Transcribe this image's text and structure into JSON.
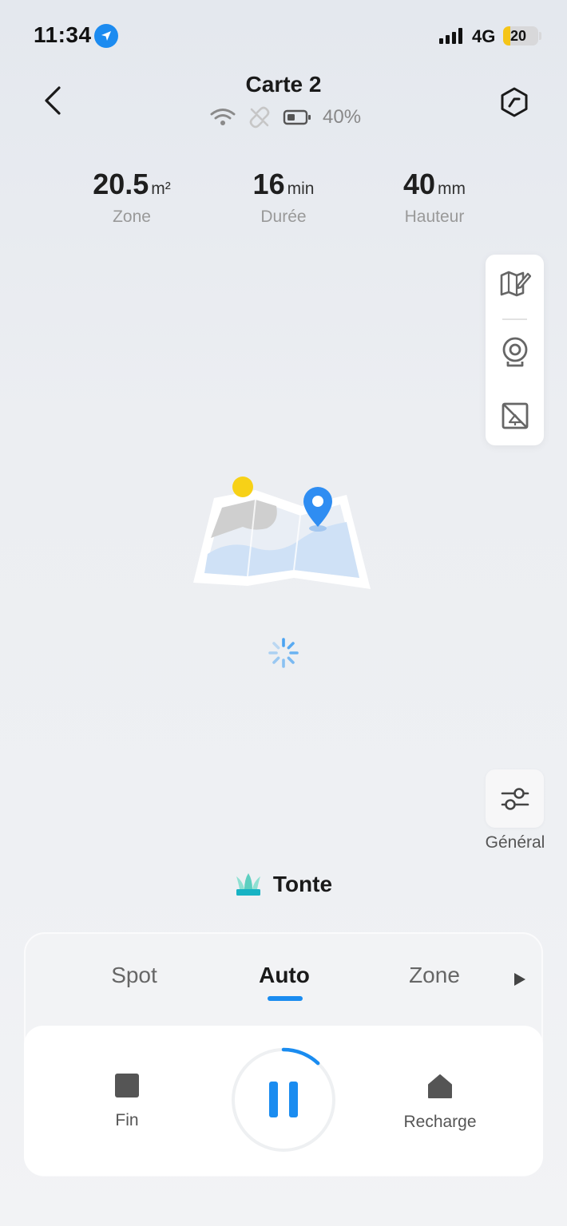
{
  "status_bar": {
    "time": "11:34",
    "network": "4G",
    "battery": "20",
    "battery_level": 0.2
  },
  "header": {
    "title": "Carte 2",
    "battery_percent": "40%"
  },
  "stats": [
    {
      "value": "20.5",
      "unit": "m²",
      "label": "Zone"
    },
    {
      "value": "16",
      "unit": "min",
      "label": "Durée"
    },
    {
      "value": "40",
      "unit": "mm",
      "label": "Hauteur"
    }
  ],
  "general": {
    "label": "Général"
  },
  "mode": {
    "title": "Tonte"
  },
  "tabs": [
    {
      "label": "Spot"
    },
    {
      "label": "Auto"
    },
    {
      "label": "Zone"
    }
  ],
  "controls": {
    "stop_label": "Fin",
    "recharge_label": "Recharge",
    "progress": 0.12
  },
  "colors": {
    "accent": "#1a8cf0",
    "sun": "#f7d117",
    "map_water": "#cfe1f6",
    "map_land": "#cfcfcf"
  },
  "icons": [
    "location-arrow-icon",
    "back-icon",
    "wifi-icon",
    "link-off-icon",
    "battery-icon",
    "settings-hex-icon",
    "map-edit-icon",
    "camera-icon",
    "no-go-zone-icon",
    "map-pin-icon",
    "loading-spinner-icon",
    "sliders-icon",
    "grass-icon",
    "play-arrow-icon",
    "stop-icon",
    "pause-icon",
    "home-icon"
  ]
}
